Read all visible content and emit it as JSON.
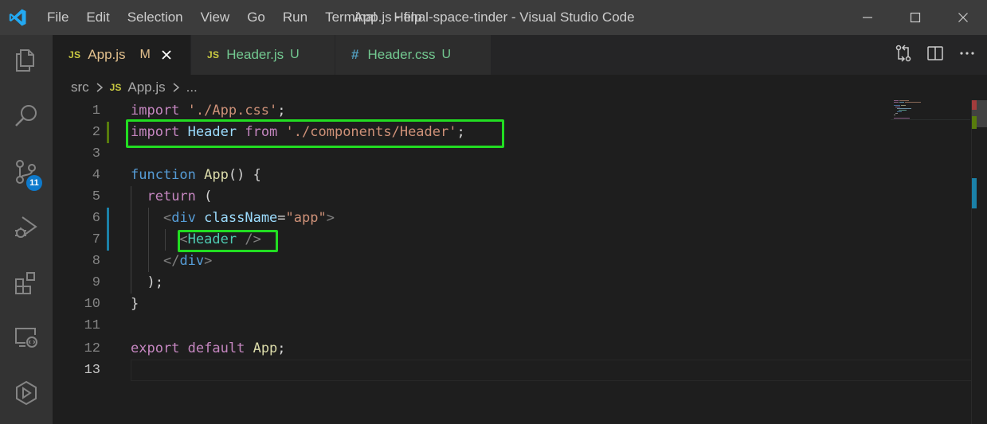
{
  "window": {
    "title": "App.js - final-space-tinder - Visual Studio Code"
  },
  "menu": [
    "File",
    "Edit",
    "Selection",
    "View",
    "Go",
    "Run",
    "Terminal",
    "Help"
  ],
  "activity_bar": {
    "items": [
      "explorer-icon",
      "search-icon",
      "source-control-icon",
      "run-debug-icon",
      "extensions-icon",
      "remote-explorer-icon",
      "live-share-icon"
    ],
    "source_control_badge": "11"
  },
  "tabs": [
    {
      "icon_text": "JS",
      "label": "App.js",
      "flag": "M",
      "active": true
    },
    {
      "icon_text": "JS",
      "label": "Header.js",
      "flag": "U",
      "active": false
    },
    {
      "icon_text": "#",
      "label": "Header.css",
      "flag": "U",
      "active": false
    }
  ],
  "breadcrumb": {
    "folder": "src",
    "file_icon": "JS",
    "file": "App.js",
    "ellipsis": "..."
  },
  "editor": {
    "line_numbers": [
      "1",
      "2",
      "3",
      "4",
      "5",
      "6",
      "7",
      "8",
      "9",
      "10",
      "11",
      "12",
      "13"
    ],
    "current_line": "13"
  },
  "colors": {
    "highlight_box": "#22dd22",
    "modified_gutter": "#1b81a8",
    "added_gutter": "#587c0c",
    "badge": "#0e7acc"
  }
}
